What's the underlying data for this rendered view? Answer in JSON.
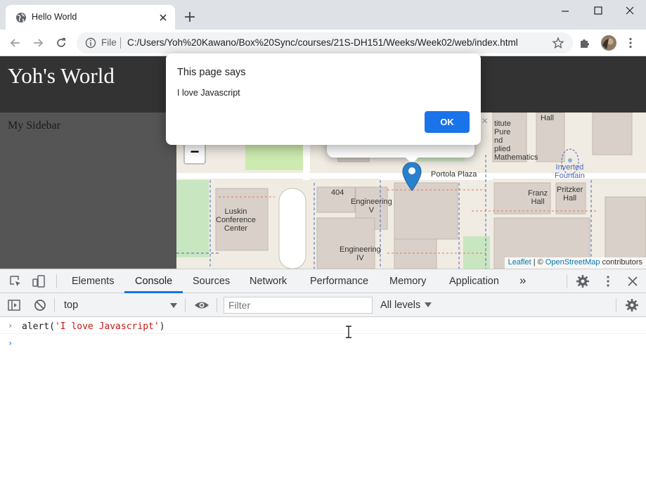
{
  "browser": {
    "tab_title": "Hello World",
    "new_tab_symbol": "+",
    "url_scheme": "File",
    "url": "C:/Users/Yoh%20Kawano/Box%20Sync/courses/21S-DH151/Weeks/Week02/web/index.html"
  },
  "page": {
    "site_title": "Yoh's World",
    "sidebar_label": "My Sidebar",
    "map": {
      "attribution_leaflet": "Leaflet",
      "attribution_sep": " | © ",
      "attribution_osm": "OpenStreetMap",
      "attribution_contrib": " contributors",
      "zoom_out": "−",
      "popup_close": "×",
      "labels": {
        "luskin": "Luskin\nConference\nCenter",
        "eng_v": "Engineering\nV",
        "eng_iv": "Engineering\nIV",
        "portola": "Portola Plaza",
        "franz": "Franz\nHall",
        "pritzker": "Pritzker\nHall",
        "institute": "titute\nPure\nnd\nplied\nMathematics",
        "hall": "Hall",
        "fountain": "Inverted\nFountain",
        "num404": "404"
      }
    }
  },
  "dialog": {
    "title": "This page says",
    "message": "I love Javascript",
    "ok_label": "OK"
  },
  "devtools": {
    "tabs": [
      "Elements",
      "Console",
      "Sources",
      "Network",
      "Performance",
      "Memory",
      "Application"
    ],
    "more_tabs": "»",
    "active_tab": "Console",
    "context": "top",
    "filter_placeholder": "Filter",
    "levels": "All levels",
    "console": {
      "command_prefix": "alert(",
      "command_string": "'I love Javascript'",
      "command_suffix": ")",
      "input_prompt": "›",
      "history_prompt": "›"
    }
  },
  "colors": {
    "accent": "#1a73e8",
    "header_bg": "#333333",
    "sidebar_bg": "#555555",
    "marker": "#2a81cb"
  }
}
